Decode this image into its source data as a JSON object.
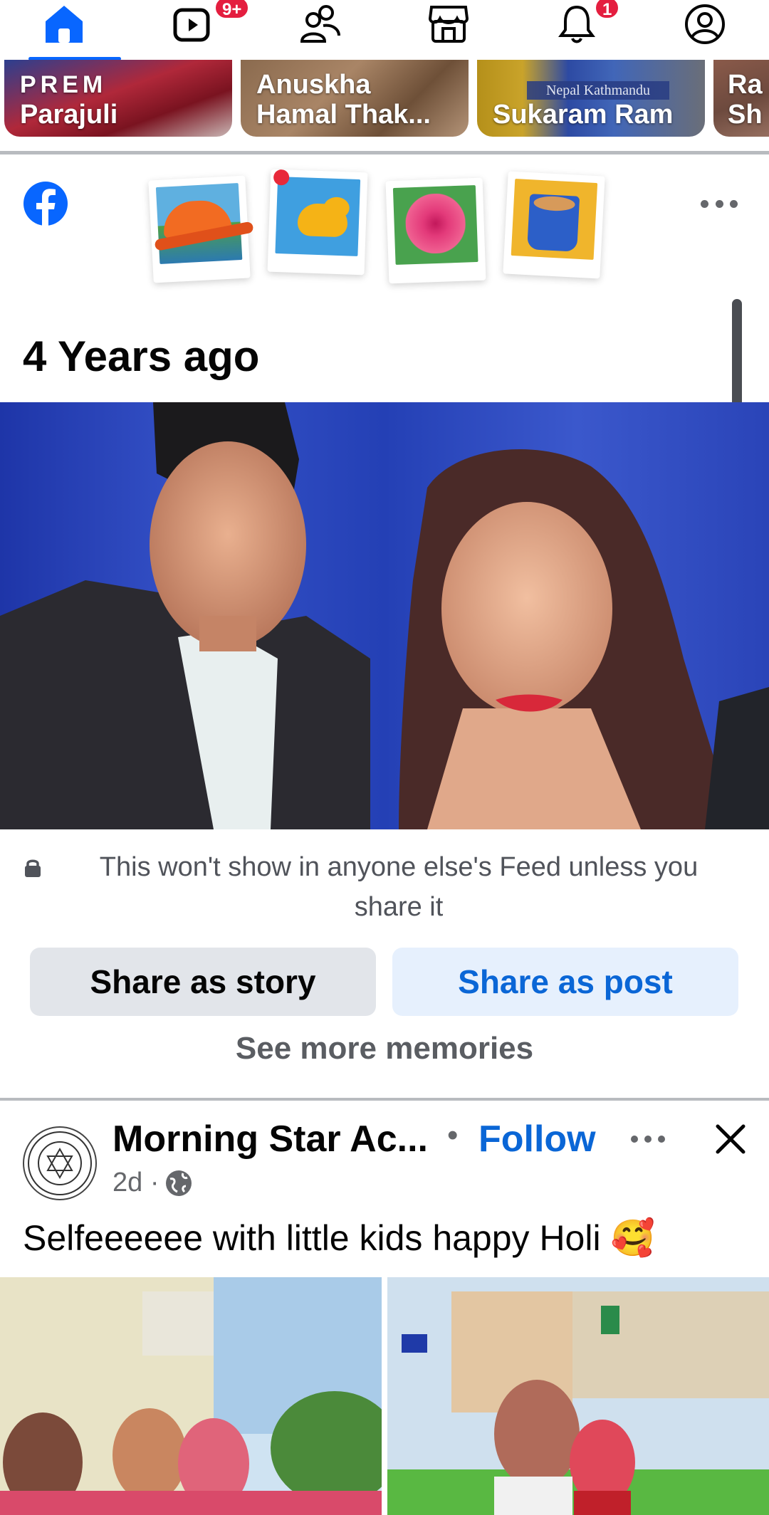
{
  "nav": {
    "tabs": [
      {
        "icon": "home-icon",
        "active": true
      },
      {
        "icon": "video-icon",
        "badge": "9+"
      },
      {
        "icon": "friends-icon"
      },
      {
        "icon": "marketplace-icon"
      },
      {
        "icon": "notifications-icon",
        "badge": "1"
      },
      {
        "icon": "profile-icon"
      }
    ],
    "colors": {
      "active": "#0866ff",
      "badge": "#e41e3f"
    }
  },
  "stories": [
    {
      "line1": "PREM",
      "line2": "Parajuli"
    },
    {
      "line1": "Anuskha",
      "line2": "Hamal Thak..."
    },
    {
      "caption": "Nepal Kathmandu",
      "line2": "Sukaram Ram"
    },
    {
      "line1": "Ra",
      "line2": "Sh"
    }
  ],
  "memories": {
    "title": "4 Years ago",
    "privacy_note": "This won't show in anyone else's Feed unless you share it",
    "share_story_label": "Share as story",
    "share_post_label": "Share as post",
    "see_more_label": "See more memories"
  },
  "post": {
    "author": "Morning Star Ac...",
    "separator": "•",
    "follow_label": "Follow",
    "time": "2d ·",
    "text": "Selfeeeeee with little kids happy Holi 🥰"
  }
}
